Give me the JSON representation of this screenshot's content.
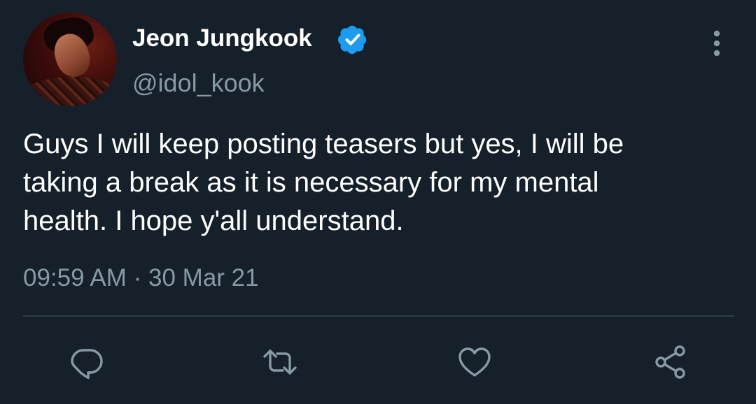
{
  "tweet": {
    "display_name": "Jeon Jungkook",
    "handle": "@idol_kook",
    "text": "Guys I will keep posting teasers but yes, I will be\ntaking a break as it is necessary for my mental\nhealth. I hope y'all understand.",
    "time": "09:59 AM",
    "separator": "·",
    "date": "30 Mar 21"
  },
  "icons": {
    "verified": "verified-badge-icon",
    "more": "more-vertical-icon",
    "reply": "reply-icon",
    "retweet": "retweet-icon",
    "like": "heart-icon",
    "share": "share-icon"
  },
  "colors": {
    "background": "#15202b",
    "primary_text": "#ffffff",
    "secondary_text": "#8899a6",
    "accent": "#1d9bf0",
    "icon": "#8899a6",
    "divider": "#2f3b47"
  }
}
